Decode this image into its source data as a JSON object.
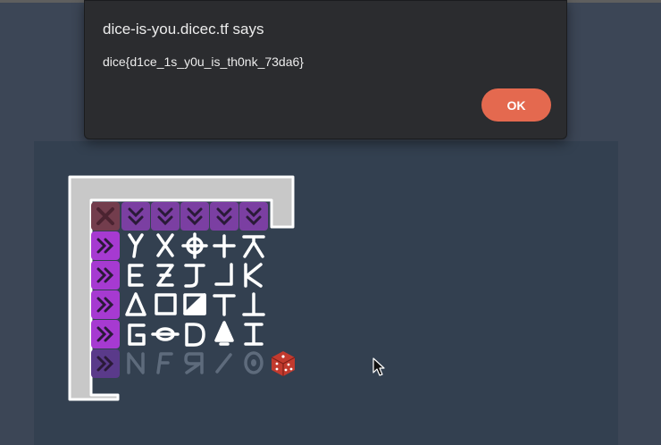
{
  "dialog": {
    "title": "dice-is-you.dicec.tf says",
    "message": "dice{d1ce_1s_y0u_is_th0nk_73da6}",
    "ok_label": "OK"
  },
  "game": {
    "rows": [
      {
        "row": 0,
        "tiles": [
          "x-block",
          "chevron-down",
          "chevron-down",
          "chevron-down",
          "chevron-down",
          "chevron-down"
        ]
      },
      {
        "row": 1,
        "tiles": [
          "chevron-right",
          "glyph-y",
          "glyph-x",
          "glyph-crosshair",
          "glyph-plus",
          "glyph-anchor"
        ]
      },
      {
        "row": 2,
        "tiles": [
          "chevron-right",
          "glyph-e",
          "glyph-z",
          "glyph-j",
          "glyph-hook",
          "glyph-k"
        ]
      },
      {
        "row": 3,
        "tiles": [
          "chevron-right",
          "glyph-triangle",
          "glyph-square",
          "glyph-half-square",
          "glyph-t",
          "glyph-upside-t"
        ]
      },
      {
        "row": 4,
        "tiles": [
          "chevron-right",
          "glyph-g",
          "glyph-theta",
          "glyph-d",
          "glyph-bell",
          "glyph-i"
        ]
      },
      {
        "row": 5,
        "tiles": [
          "chevron-right-dim",
          "glyph-n",
          "glyph-f",
          "glyph-r-mirrored",
          "glyph-slash",
          "glyph-zero",
          "dice"
        ]
      }
    ]
  },
  "colors": {
    "background": "#3c4656",
    "game_area": "#334050",
    "dialog": "#2b2c2f",
    "ok_button": "#e4694f",
    "wall": "#c8c8c8",
    "purple": "#7b3fa2",
    "magenta": "#a63ad1",
    "dice": "#c23a2e"
  }
}
